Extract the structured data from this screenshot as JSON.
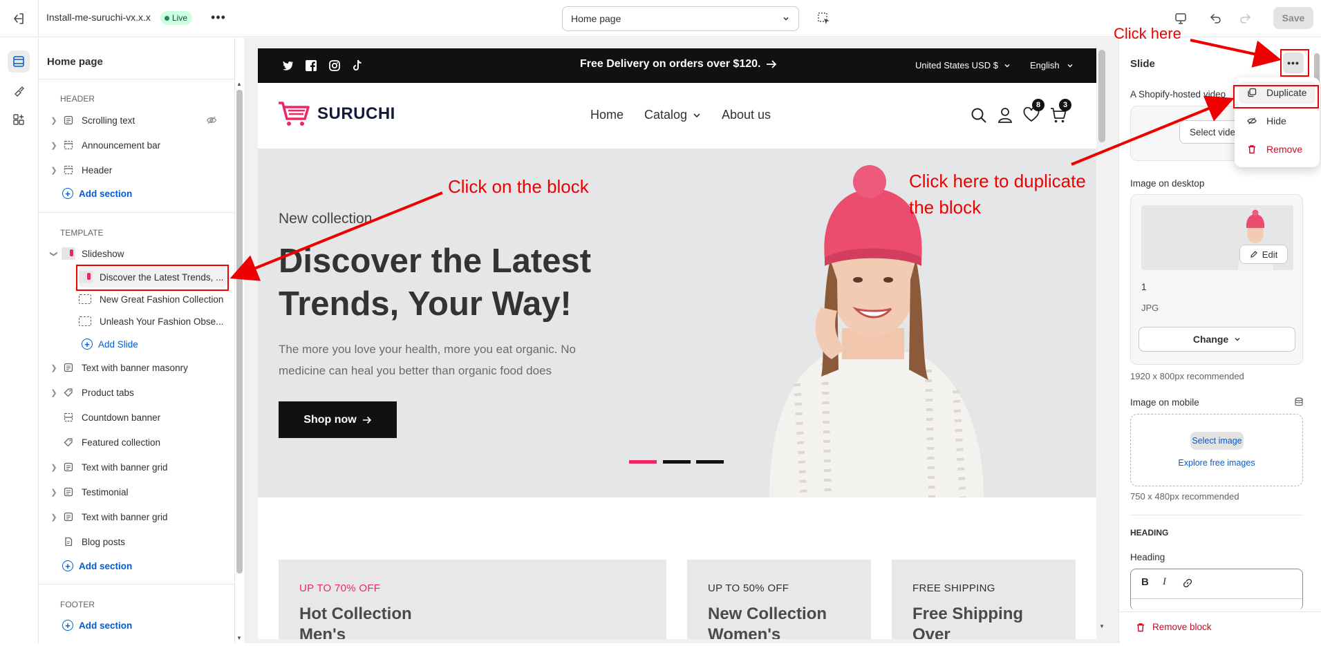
{
  "topbar": {
    "theme_name": "Install-me-suruchi-vx.x.x",
    "live_badge": "Live",
    "page_select": "Home page",
    "save_label": "Save"
  },
  "sidebar": {
    "title": "Home page",
    "header_group": "HEADER",
    "header_items": [
      {
        "label": "Scrolling text",
        "icon": "text-block-icon"
      },
      {
        "label": "Announcement bar",
        "icon": "layout-icon"
      },
      {
        "label": "Header",
        "icon": "layout-icon"
      }
    ],
    "add_section": "Add section",
    "template_group": "TEMPLATE",
    "slideshow_label": "Slideshow",
    "slides": [
      "Discover the Latest Trends, ...",
      "New Great Fashion Collection",
      "Unleash Your Fashion Obse..."
    ],
    "add_slide": "Add Slide",
    "template_items": [
      {
        "label": "Text with banner masonry",
        "icon": "text-block-icon",
        "expandable": true
      },
      {
        "label": "Product tabs",
        "icon": "tag-icon",
        "expandable": true
      },
      {
        "label": "Countdown banner",
        "icon": "layout-icon",
        "expandable": false
      },
      {
        "label": "Featured collection",
        "icon": "tag-icon",
        "expandable": false
      },
      {
        "label": "Text with banner grid",
        "icon": "text-block-icon",
        "expandable": true
      },
      {
        "label": "Testimonial",
        "icon": "text-block-icon",
        "expandable": true
      },
      {
        "label": "Text with banner grid",
        "icon": "text-block-icon",
        "expandable": true
      },
      {
        "label": "Blog posts",
        "icon": "edit-doc-icon",
        "expandable": false
      }
    ],
    "footer_group": "FOOTER"
  },
  "store": {
    "announcement": "Free Delivery on orders over $120.",
    "currency": "United States USD $",
    "language": "English",
    "logo_text": "SURUCHI",
    "nav": [
      "Home",
      "Catalog",
      "About us"
    ],
    "wishlist_count": "8",
    "cart_count": "3",
    "hero": {
      "subtitle": "New collection",
      "title_line1": "Discover the Latest",
      "title_line2": "Trends, Your Way!",
      "desc_line1": "The more you love your health, more you eat organic. No",
      "desc_line2": "medicine can heal you better than organic food does",
      "button": "Shop now"
    },
    "promos": [
      {
        "tag": "UP TO 70% OFF",
        "title_line1": "Hot Collection",
        "title_line2": "Men's",
        "tag_color": "#ee2761"
      },
      {
        "tag": "UP TO 50% OFF",
        "title_line1": "New Collection",
        "title_line2": "Women's",
        "tag_color": "#303030"
      },
      {
        "tag": "FREE SHIPPING",
        "title_line1": "Free Shipping",
        "title_line2": "Over",
        "tag_color": "#303030"
      }
    ]
  },
  "settings": {
    "title": "Slide",
    "video_label": "A Shopify-hosted video",
    "select_video": "Select video",
    "image_desktop_label": "Image on desktop",
    "edit_label": "Edit",
    "image_name": "1",
    "image_type": "JPG",
    "change_label": "Change",
    "desktop_hint": "1920 x 800px recommended",
    "image_mobile_label": "Image on mobile",
    "select_image": "Select image",
    "explore_images": "Explore free images",
    "mobile_hint": "750 x 480px recommended",
    "heading_group": "HEADING",
    "heading_label": "Heading",
    "remove_block": "Remove block"
  },
  "context_menu": {
    "duplicate": "Duplicate",
    "hide": "Hide",
    "remove": "Remove"
  },
  "annotations": {
    "click_here": "Click here",
    "click_block": "Click on the block",
    "duplicate_line1": "Click here to duplicate",
    "duplicate_line2": "the block"
  },
  "colors": {
    "annotation": "#ee0000",
    "brand_pink": "#ee2761",
    "link_blue": "#005bd3",
    "live_green": "#29845a"
  }
}
